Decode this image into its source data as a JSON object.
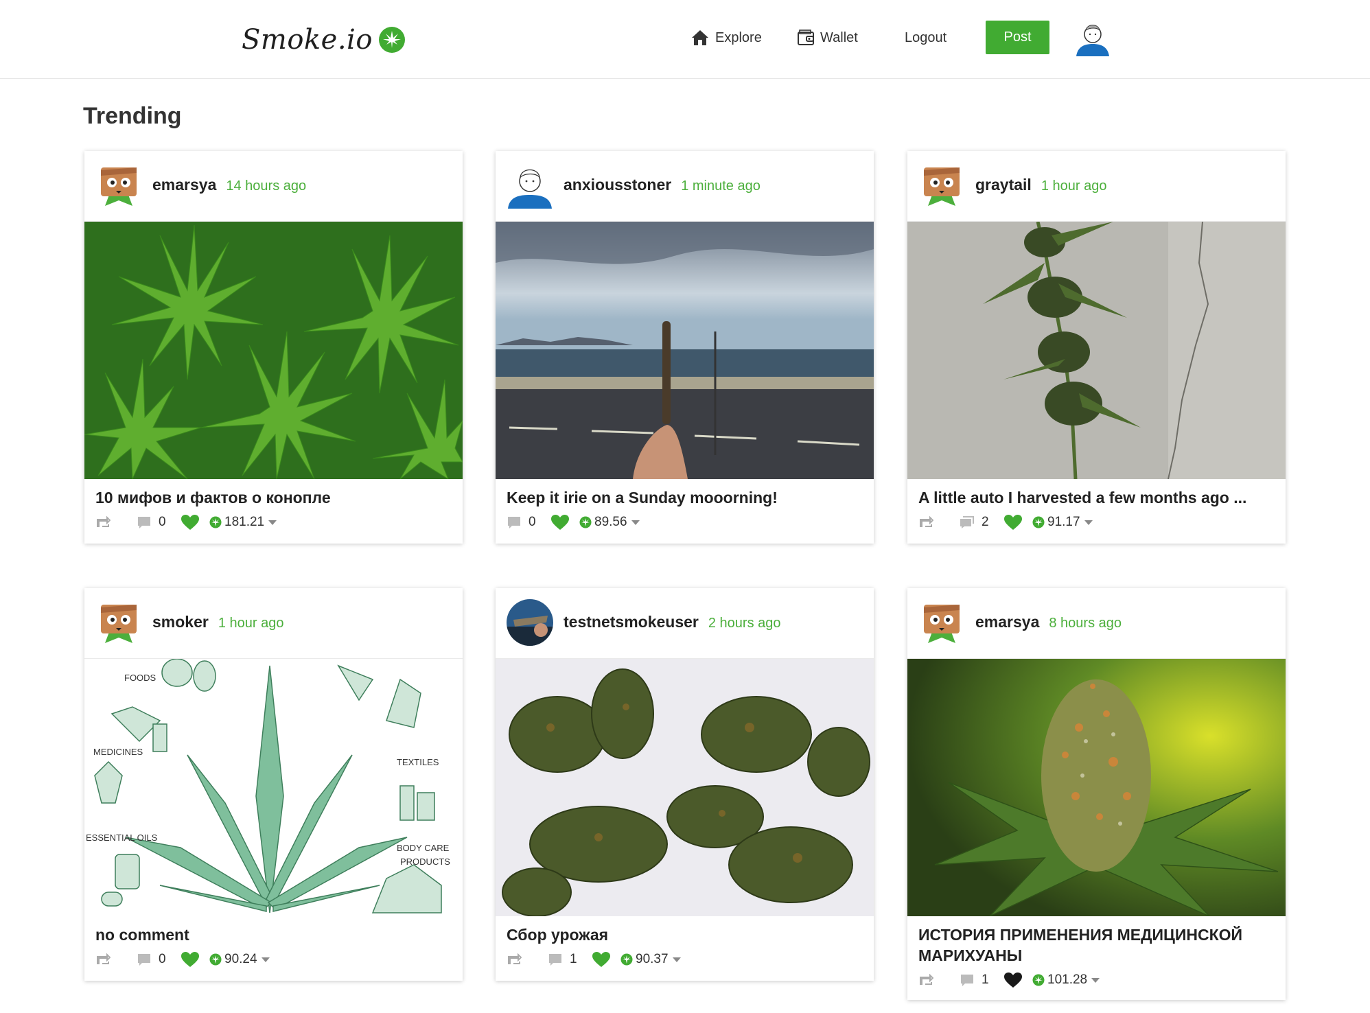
{
  "header": {
    "logo_text": "Smoke.io",
    "nav": {
      "explore": "Explore",
      "wallet": "Wallet",
      "logout": "Logout",
      "post": "Post"
    },
    "icons": [
      "home-icon",
      "wallet-icon",
      "cannabis-leaf-icon",
      "user-avatar"
    ]
  },
  "page": {
    "section_title": "Trending"
  },
  "colors": {
    "accent": "#41ab32",
    "time_text": "#4caf3c"
  },
  "posts": [
    {
      "author": "emarsya",
      "time": "14 hours ago",
      "title": "10 мифов и фактов о конопле",
      "comments": "0",
      "payout": "181.21",
      "liked": true
    },
    {
      "author": "anxiousstoner",
      "time": "1 minute ago",
      "title": "Keep it irie on a Sunday mooorning!",
      "comments": "0",
      "payout": "89.56",
      "liked": true
    },
    {
      "author": "graytail",
      "time": "1 hour ago",
      "title": "A little auto I harvested a few months ago ...",
      "comments": "2",
      "payout": "91.17",
      "liked": true
    },
    {
      "author": "smoker",
      "time": "1 hour ago",
      "title": "no comment",
      "comments": "0",
      "payout": "90.24",
      "liked": true
    },
    {
      "author": "testnetsmokeuser",
      "time": "2 hours ago",
      "title": "Сбор урожая",
      "comments": "1",
      "payout": "90.37",
      "liked": true
    },
    {
      "author": "emarsya",
      "time": "8 hours ago",
      "title": "ИСТОРИЯ ПРИМЕНЕНИЯ МЕДИЦИНСКОЙ МАРИХУАНЫ",
      "comments": "1",
      "payout": "101.28",
      "liked": false
    }
  ],
  "post_images": {
    "smoker_diagram_labels": [
      "FOODS",
      "MEDICINES",
      "TEXTILES",
      "ESSENTIAL OILS",
      "BODY CARE",
      "PRODUCTS"
    ]
  }
}
